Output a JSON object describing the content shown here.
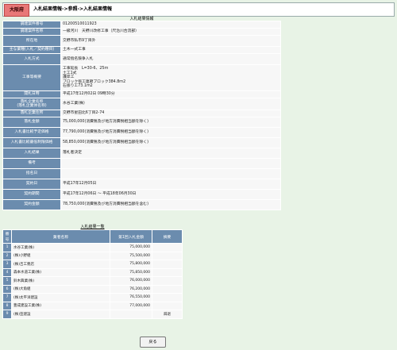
{
  "header": {
    "prefecture": "大阪府",
    "breadcrumb": "入札結果情報->参照->入札結果情報"
  },
  "info_section_title": "入札結果情報",
  "info_rows": [
    {
      "key": "調達案件番号",
      "value": "01200510011923"
    },
    {
      "key": "調達案件名称",
      "value": "一級河川　天野川改修工事（尺治川合流部）"
    },
    {
      "key": "所在地",
      "value": "交野市私市9丁目外"
    },
    {
      "key": "主な業種(入札／契約種目)",
      "value": "土木一式工事"
    },
    {
      "key": "入札方式",
      "value": "通常指名競争入札"
    },
    {
      "key": "工事等概要",
      "lines": [
        "工事延長　L=30‐6、25ｍ",
        "土工1式",
        "護岸工",
        "ブロック張工連節ブロック384.8ｍ2",
        "石張り工73.1ｍ2"
      ]
    },
    {
      "key": "開札日時",
      "value": "平成17年12月02日 09時30分"
    },
    {
      "key": "落札企業名称\n(落札企業体名称)",
      "value": "水谷工業(株)"
    },
    {
      "key": "落札企業住所",
      "value": "交野市星田北6丁目2-74"
    },
    {
      "key": "落札金額",
      "value": "75,000,000(消費税及び地方消費税相当額を除く)"
    },
    {
      "key": "入札書比較予定価格",
      "value": "77,790,000(消費税及び地方消費税相当額を除く)"
    },
    {
      "key": "入札書比較最低制限価格",
      "value": "58,850,000(消費税及び地方消費税相当額を除く)"
    },
    {
      "key": "入札結果",
      "value": "落札者決定"
    },
    {
      "key": "備考",
      "value": ""
    },
    {
      "key": "指名日",
      "value": ""
    },
    {
      "key": "契約日",
      "value": "平成17年12月05日"
    },
    {
      "key": "契約期間",
      "value": "平成17年12月06日 ～ 平成18年06月30日"
    },
    {
      "key": "契約金額",
      "value": "78,750,000(消費税及び地方消費税相当額を含む)"
    }
  ],
  "results_section_title": "入札結果一覧",
  "results": {
    "headers": [
      "番号",
      "業者名称",
      "第1回入札金額",
      "摘要"
    ],
    "rows": [
      {
        "no": "1",
        "name": "水谷工業(株)",
        "amount": "75,000,000",
        "remark": ""
      },
      {
        "no": "2",
        "name": "(株)小野組",
        "amount": "75,500,000",
        "remark": ""
      },
      {
        "no": "3",
        "name": "(株)吉工務店",
        "amount": "75,800,000",
        "remark": ""
      },
      {
        "no": "4",
        "name": "森本水道工業(株)",
        "amount": "75,850,000",
        "remark": ""
      },
      {
        "no": "5",
        "name": "鈴木興業(株)",
        "amount": "76,000,000",
        "remark": ""
      },
      {
        "no": "6",
        "name": "(株)大角組",
        "amount": "76,200,000",
        "remark": ""
      },
      {
        "no": "7",
        "name": "(株)太平洋建設",
        "amount": "76,550,000",
        "remark": ""
      },
      {
        "no": "8",
        "name": "豊成建設工業(株)",
        "amount": "77,000,000",
        "remark": ""
      },
      {
        "no": "9",
        "name": "(株)笠建設",
        "amount": "",
        "remark": "辞退"
      }
    ]
  },
  "back_button_label": "戻る"
}
